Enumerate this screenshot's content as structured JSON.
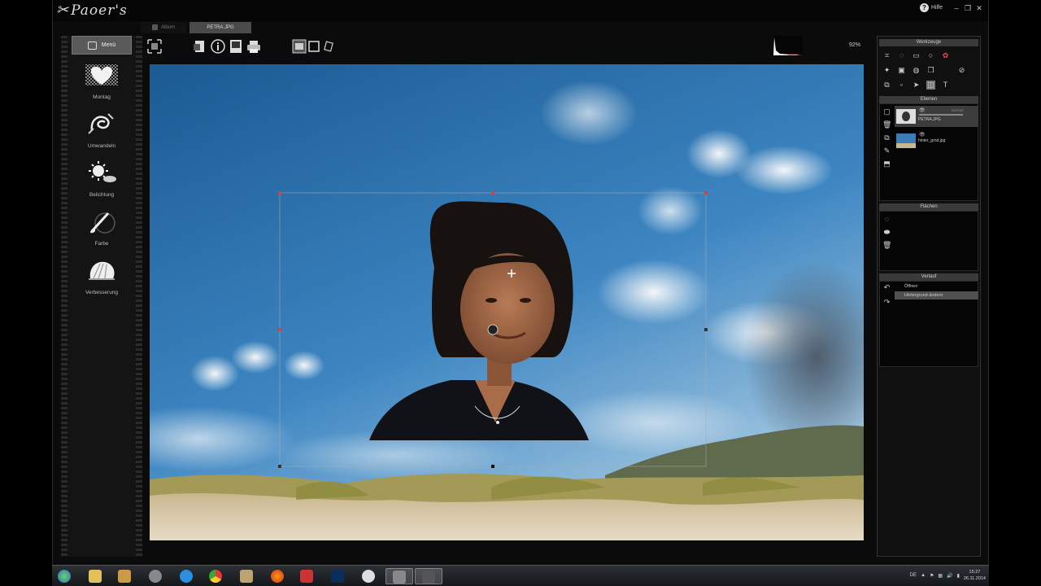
{
  "app": {
    "logo_text": "Paoer's",
    "help_label": "Hilfe"
  },
  "tabs": [
    {
      "label": "Album"
    },
    {
      "label": "PETRA.JPG"
    }
  ],
  "sidebar": {
    "menu_label": "Menü",
    "tools": [
      {
        "label": "Montag",
        "icon": "heart-icon"
      },
      {
        "label": "Umwandeln",
        "icon": "swirl-icon"
      },
      {
        "label": "Belichtung",
        "icon": "sun-icon"
      },
      {
        "label": "Farbe",
        "icon": "brush-icon"
      },
      {
        "label": "Verbesserung",
        "icon": "shell-icon"
      }
    ]
  },
  "toolbar": {
    "zoom": "92%"
  },
  "right_panel": {
    "tools_title": "Werkzeuge",
    "layers_title": "Ebenen",
    "layers": [
      {
        "name": "PETRA.JPG",
        "mode": "Normal"
      },
      {
        "name": "hinter_grnd.jpg",
        "mode": ""
      }
    ],
    "surfaces_title": "Flächen",
    "history_title": "Verlauf",
    "history": [
      {
        "label": "Öffnen"
      },
      {
        "label": "Hintergrund ändern"
      }
    ]
  },
  "taskbar": {
    "tray_lang": "DE",
    "clock_time": "15:27",
    "clock_date": "26.11.2014"
  },
  "colors": {
    "window_bg": "#0b0b0b",
    "panel_bg": "#101010",
    "sky_top": "#1e5d96",
    "sky_bottom": "#7fb2d8",
    "accent": "#4a4a4a"
  }
}
